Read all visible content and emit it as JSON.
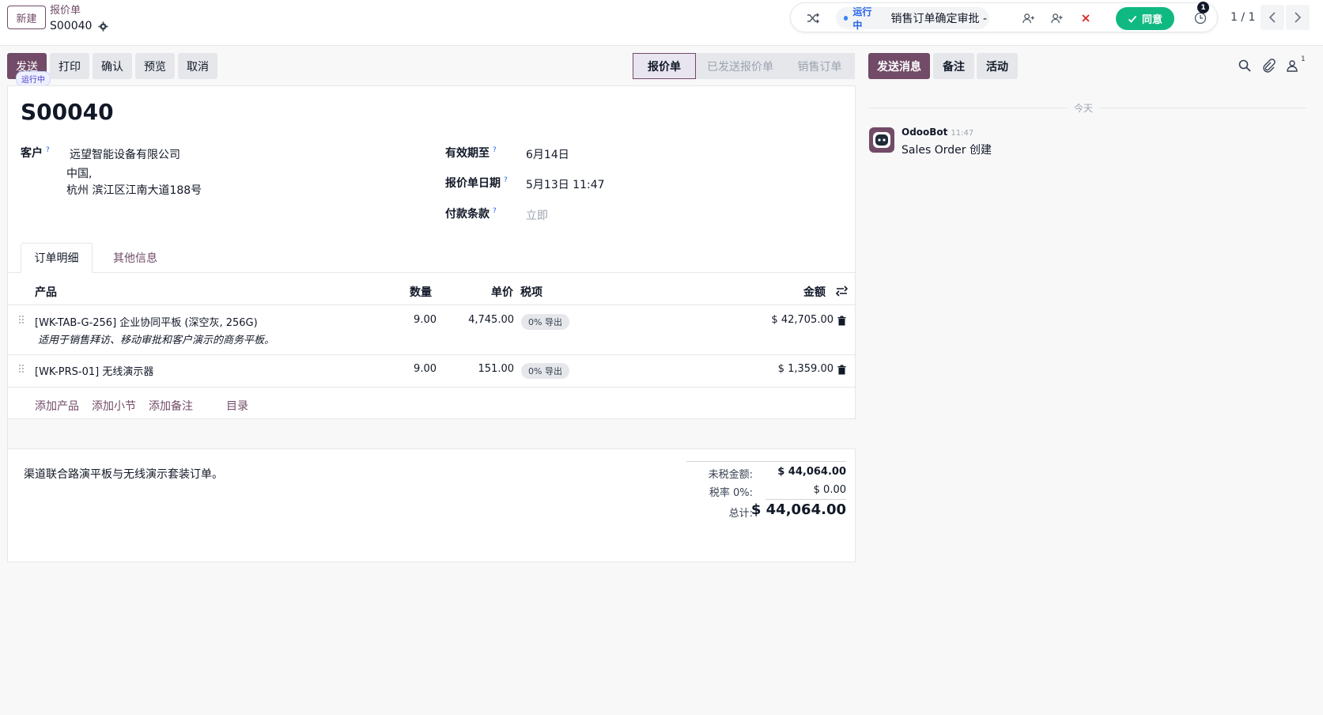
{
  "breadcrumb": {
    "new_label": "新建",
    "parent": "报价单",
    "current": "S00040"
  },
  "approval": {
    "status": "运行中",
    "title": "销售订单确定审批 - ...",
    "agree_label": "同意",
    "activity_count": "1"
  },
  "pager": {
    "text": "1 / 1"
  },
  "actions": {
    "send": "发送",
    "print": "打印",
    "confirm": "确认",
    "preview": "预览",
    "cancel": "取消",
    "running_badge": "运行中"
  },
  "status_stages": [
    "报价单",
    "已发送报价单",
    "销售订单"
  ],
  "form": {
    "title": "S00040",
    "customer_label": "客户",
    "customer_name": "远望智能设备有限公司",
    "customer_line2": "中国,",
    "customer_line3": "杭州 滨江区江南大道188号",
    "validity_label": "有效期至",
    "validity_value": "6月14日",
    "date_label": "报价单日期",
    "date_value": "5月13日 11:47",
    "payment_label": "付款条款",
    "payment_placeholder": "立即",
    "help_mark": "?"
  },
  "tabs": {
    "order_lines": "订单明细",
    "other_info": "其他信息"
  },
  "table": {
    "headers": {
      "product": "产品",
      "qty": "数量",
      "price": "单价",
      "tax": "税项",
      "amount": "金额"
    },
    "rows": [
      {
        "product": "[WK-TAB-G-256] 企业协同平板 (深空灰, 256G)",
        "description": "适用于销售拜访、移动审批和客户演示的商务平板。",
        "qty": "9.00",
        "price": "4,745.00",
        "tax": "0% 导出",
        "amount": "$ 42,705.00"
      },
      {
        "product": "[WK-PRS-01] 无线演示器",
        "qty": "9.00",
        "price": "151.00",
        "tax": "0% 导出",
        "amount": "$ 1,359.00"
      }
    ],
    "add_links": {
      "product": "添加产品",
      "section": "添加小节",
      "note": "添加备注",
      "catalog": "目录"
    }
  },
  "note": "渠道联合路演平板与无线演示套装订单。",
  "totals": {
    "untaxed_label": "未税金额:",
    "untaxed_value": "$ 44,064.00",
    "tax_label": "税率 0%:",
    "tax_value": "$ 0.00",
    "total_label": "总计:",
    "total_value": "$ 44,064.00"
  },
  "chatter": {
    "send_message": "发送消息",
    "log_note": "备注",
    "activity": "活动",
    "followers_count": "1",
    "today": "今天",
    "author": "OdooBot",
    "time": "11:47",
    "message": "Sales Order 创建"
  },
  "colors": {
    "brand": "#714b67",
    "agree": "#10b981",
    "running": "#2563eb"
  }
}
